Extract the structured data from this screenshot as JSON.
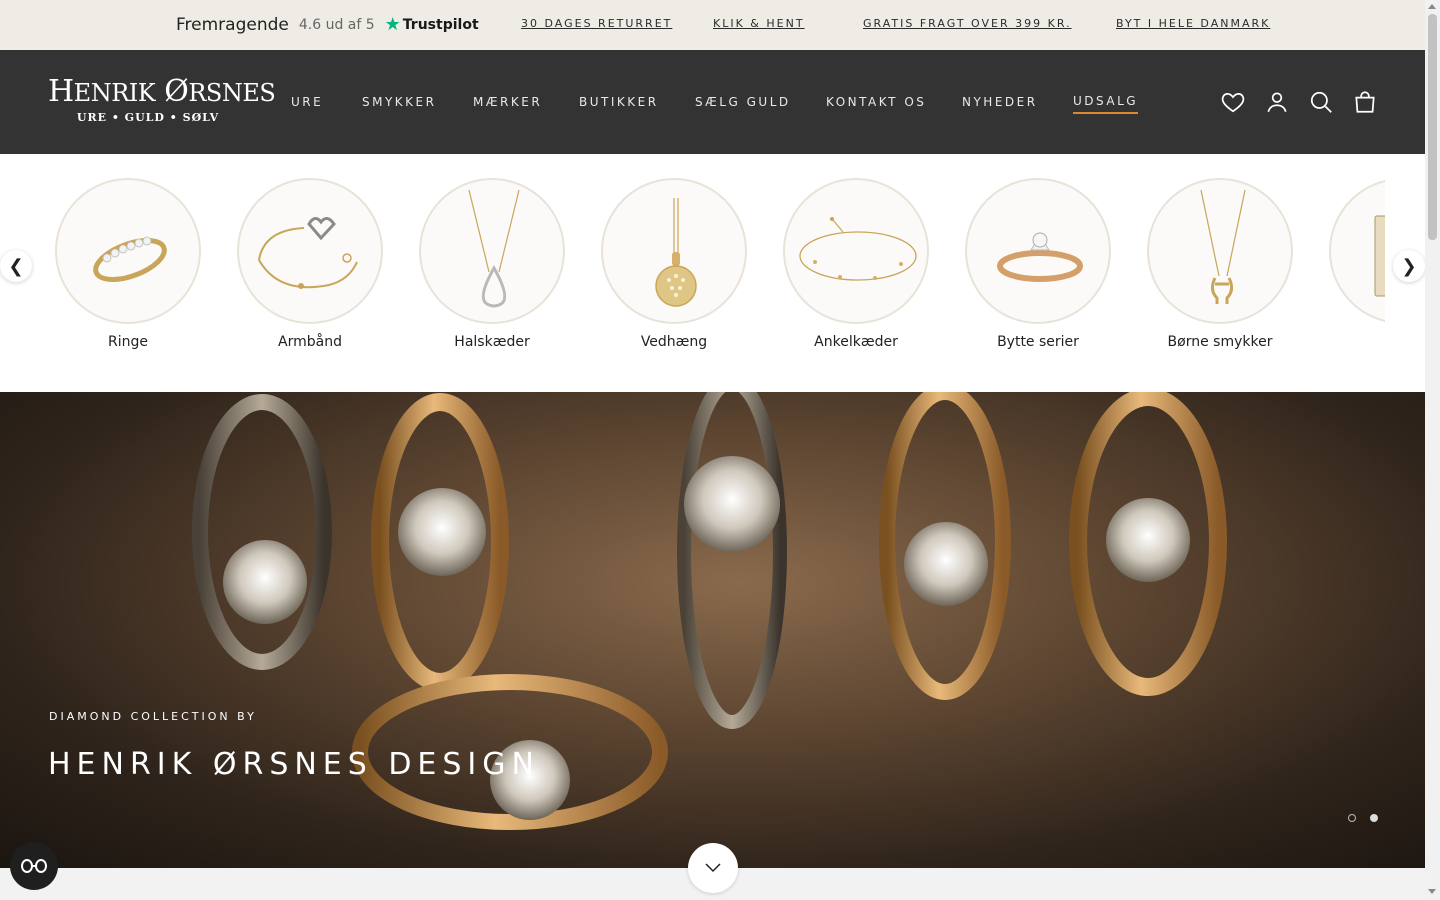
{
  "announcement": {
    "rating_text": "Fremragende",
    "score_text": "4.6 ud af 5",
    "trustpilot_label": "Trustpilot",
    "usps": [
      "30 DAGES RETURRET",
      " KLIK & HENT",
      "GRATIS FRAGT OVER 399 KR.",
      "BYT I HELE DANMARK"
    ]
  },
  "header": {
    "logo": {
      "name_first_initial": "H",
      "name_first_rest": "ENRIK",
      "name_second_initial": "Ø",
      "name_second_rest": "RSNES",
      "tagline": "URE • GULD • SØLV"
    },
    "nav": [
      "URE",
      "SMYKKER",
      "MÆRKER",
      "BUTIKKER",
      "SÆLG GULD",
      "KONTAKT OS",
      "NYHEDER",
      "UDSALG"
    ],
    "icons": [
      "heart-icon",
      "account-icon",
      "search-icon",
      "bag-icon"
    ],
    "accent_color": "#d98a2b"
  },
  "categories": {
    "items": [
      "Ringe",
      "Armbånd",
      "Halskæder",
      "Vedhæng",
      "Ankelkæder",
      "Bytte serier",
      "Børne smykker"
    ],
    "prev_glyph": "❮",
    "next_glyph": "❯"
  },
  "hero": {
    "kicker": "DIAMOND COLLECTION BY",
    "title": "HENRIK ØRSNES DESIGN",
    "slide_count": 2,
    "active_slide": 2
  },
  "colors": {
    "header_bg": "#333333",
    "topbar_bg": "#efece6",
    "trustpilot_green": "#00b67a"
  }
}
